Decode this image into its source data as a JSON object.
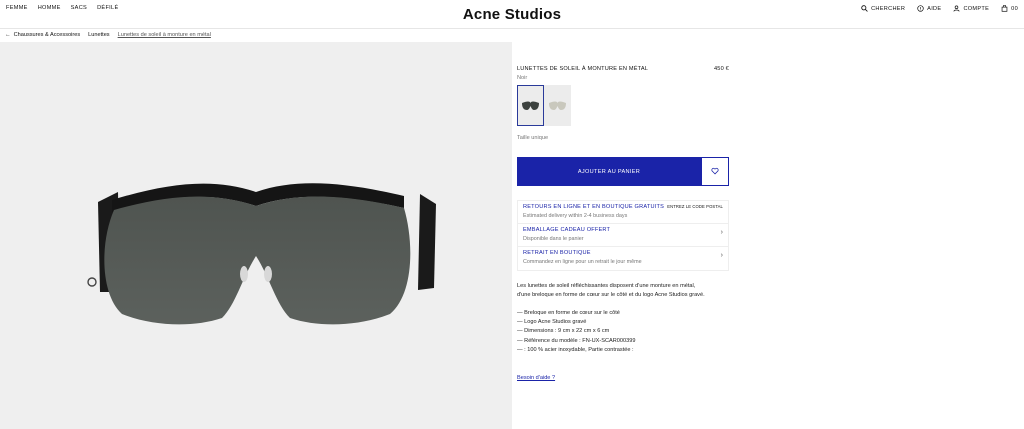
{
  "nav": {
    "left": [
      "FEMME",
      "HOMME",
      "SACS",
      "DÉFILÉ"
    ],
    "logo": "Acne Studios",
    "search": "CHERCHER",
    "help": "AIDE",
    "account": "COMPTE",
    "cart_count": "00"
  },
  "breadcrumb": {
    "items": [
      "Chaussures & Accessoires",
      "Lunettes",
      "Lunettes de soleil à monture en métal"
    ]
  },
  "product": {
    "title": "LUNETTES DE SOLEIL À MONTURE EN MÉTAL",
    "price": "450 €",
    "color": "Noir",
    "size": "Taille unique",
    "add_to_cart": "AJOUTER AU PANIER"
  },
  "info": [
    {
      "title": "RETOURS EN LIGNE ET EN BOUTIQUE GRATUITS",
      "sub": "Estimated delivery within 2-4 business days",
      "aside": "ENTREZ LE CODE POSTAL"
    },
    {
      "title": "EMBALLAGE CADEAU OFFERT",
      "sub": "Disponible dans le panier"
    },
    {
      "title": "RETRAIT EN BOUTIQUE",
      "sub": "Commandez en ligne pour un retrait le jour même"
    }
  ],
  "description": {
    "line1": "Les lunettes de soleil réfléchissantes disposent d'une monture en métal,",
    "line2": "d'une breloque en forme de cœur sur le côté et du logo Acne Studios gravé."
  },
  "bullets": [
    "—  Breloque en forme de cœur sur le côté",
    "—  Logo Acne Studios gravé",
    "—  Dimensions : 9 cm x 22 cm x 6 cm",
    "—  Référence du modèle : FN-UX-SCAR000399",
    "—     : 100 % acier inoxydable, Partie contrastée :"
  ],
  "help_link": "Besoin d'aide ?",
  "colors": {
    "accent": "#1a23a8",
    "image_bg": "#efefef"
  }
}
